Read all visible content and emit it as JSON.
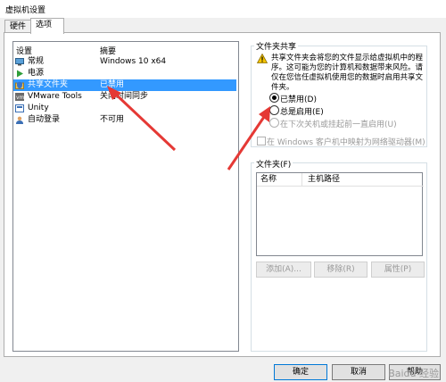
{
  "window": {
    "title": "虚拟机设置"
  },
  "tabs": [
    {
      "label": "硬件",
      "active": false
    },
    {
      "label": "选项",
      "active": true
    }
  ],
  "settings_list": {
    "header_setting": "设置",
    "header_summary": "摘要",
    "rows": [
      {
        "name": "常规",
        "summary": "Windows 10 x64",
        "icon": "monitor-icon",
        "selected": false
      },
      {
        "name": "电源",
        "summary": "",
        "icon": "play-icon",
        "selected": false
      },
      {
        "name": "共享文件夹",
        "summary": "已禁用",
        "icon": "shield-folder-icon",
        "selected": true
      },
      {
        "name": "VMware Tools",
        "summary": "关闭时间同步",
        "icon": "vm-icon",
        "selected": false
      },
      {
        "name": "Unity",
        "summary": "",
        "icon": "unity-icon",
        "selected": false
      },
      {
        "name": "自动登录",
        "summary": "不可用",
        "icon": "user-icon",
        "selected": false
      }
    ]
  },
  "folder_sharing": {
    "legend": "文件夹共享",
    "warning": "共享文件夹会将您的文件显示给虚拟机中的程序。这可能为您的计算机和数据带来风险。请仅在您信任虚拟机使用您的数据时启用共享文件夹。",
    "radio_disabled": "已禁用(D)",
    "radio_always": "总是启用(E)",
    "radio_until_off": "在下次关机或挂起前一直启用(U)",
    "map_drive": "在 Windows 客户机中映射为网络驱动器(M)"
  },
  "folders": {
    "legend": "文件夹(F)",
    "col_name": "名称",
    "col_path": "主机路径",
    "add": "添加(A)...",
    "remove": "移除(R)",
    "properties": "属性(P)"
  },
  "footer": {
    "ok": "确定",
    "cancel": "取消",
    "help": "帮助"
  },
  "watermark": "Baidu 经验",
  "colors": {
    "selection": "#3399ff",
    "arrow": "#e53935",
    "warning": "#f5c400"
  }
}
